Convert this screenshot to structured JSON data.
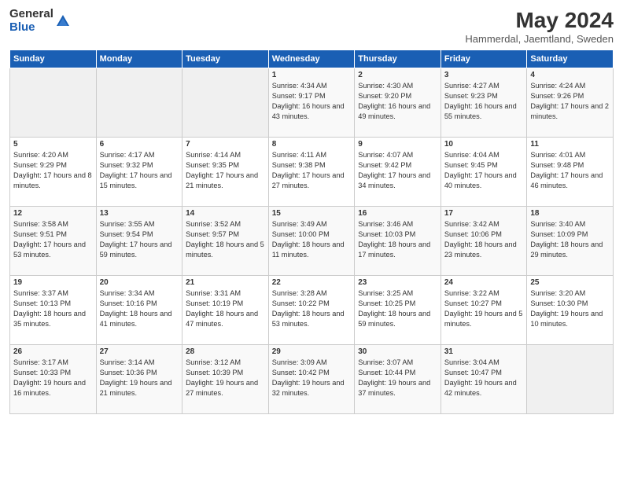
{
  "header": {
    "logo_general": "General",
    "logo_blue": "Blue",
    "title": "May 2024",
    "subtitle": "Hammerdal, Jaemtland, Sweden"
  },
  "columns": [
    "Sunday",
    "Monday",
    "Tuesday",
    "Wednesday",
    "Thursday",
    "Friday",
    "Saturday"
  ],
  "weeks": [
    [
      {
        "day": "",
        "info": ""
      },
      {
        "day": "",
        "info": ""
      },
      {
        "day": "",
        "info": ""
      },
      {
        "day": "1",
        "info": "Sunrise: 4:34 AM\nSunset: 9:17 PM\nDaylight: 16 hours and 43 minutes."
      },
      {
        "day": "2",
        "info": "Sunrise: 4:30 AM\nSunset: 9:20 PM\nDaylight: 16 hours and 49 minutes."
      },
      {
        "day": "3",
        "info": "Sunrise: 4:27 AM\nSunset: 9:23 PM\nDaylight: 16 hours and 55 minutes."
      },
      {
        "day": "4",
        "info": "Sunrise: 4:24 AM\nSunset: 9:26 PM\nDaylight: 17 hours and 2 minutes."
      }
    ],
    [
      {
        "day": "5",
        "info": "Sunrise: 4:20 AM\nSunset: 9:29 PM\nDaylight: 17 hours and 8 minutes."
      },
      {
        "day": "6",
        "info": "Sunrise: 4:17 AM\nSunset: 9:32 PM\nDaylight: 17 hours and 15 minutes."
      },
      {
        "day": "7",
        "info": "Sunrise: 4:14 AM\nSunset: 9:35 PM\nDaylight: 17 hours and 21 minutes."
      },
      {
        "day": "8",
        "info": "Sunrise: 4:11 AM\nSunset: 9:38 PM\nDaylight: 17 hours and 27 minutes."
      },
      {
        "day": "9",
        "info": "Sunrise: 4:07 AM\nSunset: 9:42 PM\nDaylight: 17 hours and 34 minutes."
      },
      {
        "day": "10",
        "info": "Sunrise: 4:04 AM\nSunset: 9:45 PM\nDaylight: 17 hours and 40 minutes."
      },
      {
        "day": "11",
        "info": "Sunrise: 4:01 AM\nSunset: 9:48 PM\nDaylight: 17 hours and 46 minutes."
      }
    ],
    [
      {
        "day": "12",
        "info": "Sunrise: 3:58 AM\nSunset: 9:51 PM\nDaylight: 17 hours and 53 minutes."
      },
      {
        "day": "13",
        "info": "Sunrise: 3:55 AM\nSunset: 9:54 PM\nDaylight: 17 hours and 59 minutes."
      },
      {
        "day": "14",
        "info": "Sunrise: 3:52 AM\nSunset: 9:57 PM\nDaylight: 18 hours and 5 minutes."
      },
      {
        "day": "15",
        "info": "Sunrise: 3:49 AM\nSunset: 10:00 PM\nDaylight: 18 hours and 11 minutes."
      },
      {
        "day": "16",
        "info": "Sunrise: 3:46 AM\nSunset: 10:03 PM\nDaylight: 18 hours and 17 minutes."
      },
      {
        "day": "17",
        "info": "Sunrise: 3:42 AM\nSunset: 10:06 PM\nDaylight: 18 hours and 23 minutes."
      },
      {
        "day": "18",
        "info": "Sunrise: 3:40 AM\nSunset: 10:09 PM\nDaylight: 18 hours and 29 minutes."
      }
    ],
    [
      {
        "day": "19",
        "info": "Sunrise: 3:37 AM\nSunset: 10:13 PM\nDaylight: 18 hours and 35 minutes."
      },
      {
        "day": "20",
        "info": "Sunrise: 3:34 AM\nSunset: 10:16 PM\nDaylight: 18 hours and 41 minutes."
      },
      {
        "day": "21",
        "info": "Sunrise: 3:31 AM\nSunset: 10:19 PM\nDaylight: 18 hours and 47 minutes."
      },
      {
        "day": "22",
        "info": "Sunrise: 3:28 AM\nSunset: 10:22 PM\nDaylight: 18 hours and 53 minutes."
      },
      {
        "day": "23",
        "info": "Sunrise: 3:25 AM\nSunset: 10:25 PM\nDaylight: 18 hours and 59 minutes."
      },
      {
        "day": "24",
        "info": "Sunrise: 3:22 AM\nSunset: 10:27 PM\nDaylight: 19 hours and 5 minutes."
      },
      {
        "day": "25",
        "info": "Sunrise: 3:20 AM\nSunset: 10:30 PM\nDaylight: 19 hours and 10 minutes."
      }
    ],
    [
      {
        "day": "26",
        "info": "Sunrise: 3:17 AM\nSunset: 10:33 PM\nDaylight: 19 hours and 16 minutes."
      },
      {
        "day": "27",
        "info": "Sunrise: 3:14 AM\nSunset: 10:36 PM\nDaylight: 19 hours and 21 minutes."
      },
      {
        "day": "28",
        "info": "Sunrise: 3:12 AM\nSunset: 10:39 PM\nDaylight: 19 hours and 27 minutes."
      },
      {
        "day": "29",
        "info": "Sunrise: 3:09 AM\nSunset: 10:42 PM\nDaylight: 19 hours and 32 minutes."
      },
      {
        "day": "30",
        "info": "Sunrise: 3:07 AM\nSunset: 10:44 PM\nDaylight: 19 hours and 37 minutes."
      },
      {
        "day": "31",
        "info": "Sunrise: 3:04 AM\nSunset: 10:47 PM\nDaylight: 19 hours and 42 minutes."
      },
      {
        "day": "",
        "info": ""
      }
    ]
  ]
}
